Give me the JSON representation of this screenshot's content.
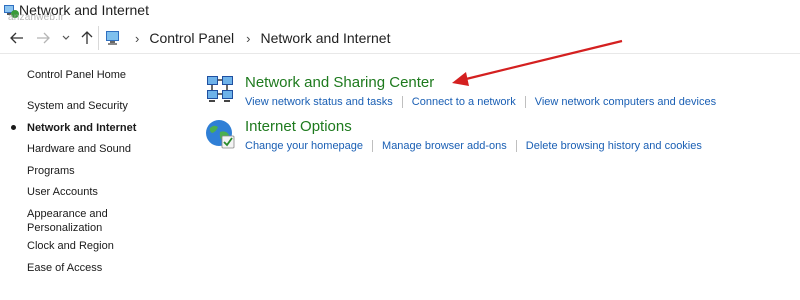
{
  "window": {
    "title": "Network and Internet",
    "watermark": "anzahweb.ir"
  },
  "address_bar": {
    "crumbs": [
      "Control Panel",
      "Network and Internet"
    ],
    "separator": "›"
  },
  "sidebar": {
    "home": "Control Panel Home",
    "items": [
      "System and Security",
      "Network and Internet",
      "Hardware and Sound",
      "Programs",
      "User Accounts",
      "Appearance and Personalization",
      "Clock and Region",
      "Ease of Access"
    ],
    "appearance_line1": "Appearance and",
    "appearance_line2": "Personalization",
    "active": "Network and Internet"
  },
  "categories": [
    {
      "title": "Network and Sharing Center",
      "icon": "network-sharing-icon",
      "links": [
        "View network status and tasks",
        "Connect to a network",
        "View network computers and devices"
      ]
    },
    {
      "title": "Internet Options",
      "icon": "internet-options-icon",
      "links": [
        "Change your homepage",
        "Manage browser add-ons",
        "Delete browsing history and cookies"
      ]
    }
  ],
  "colors": {
    "category_title": "#1e7a1e",
    "link": "#1a5fb4",
    "annotation_arrow": "#d42020"
  }
}
